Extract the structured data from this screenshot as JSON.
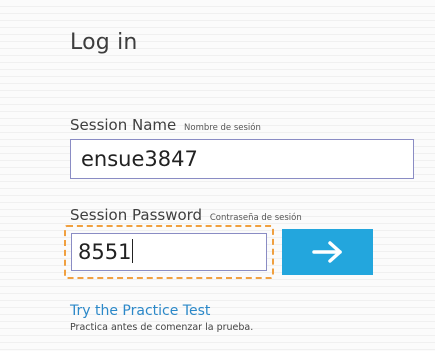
{
  "login": {
    "title": "Log in",
    "session_name": {
      "label": "Session Name",
      "label_es": "Nombre de sesión",
      "value": "ensue3847"
    },
    "session_password": {
      "label": "Session Password",
      "label_es": "Contraseña de sesión",
      "value": "8551"
    },
    "submit_icon": "right-arrow-icon",
    "practice_link": "Try the Practice Test",
    "practice_note": "Practica antes de comenzar la prueba."
  },
  "colors": {
    "accent_button": "#23a6dd",
    "link": "#2b88c8",
    "focus_dashed_outline": "#f0a040",
    "input_border": "#8a8cc4"
  }
}
